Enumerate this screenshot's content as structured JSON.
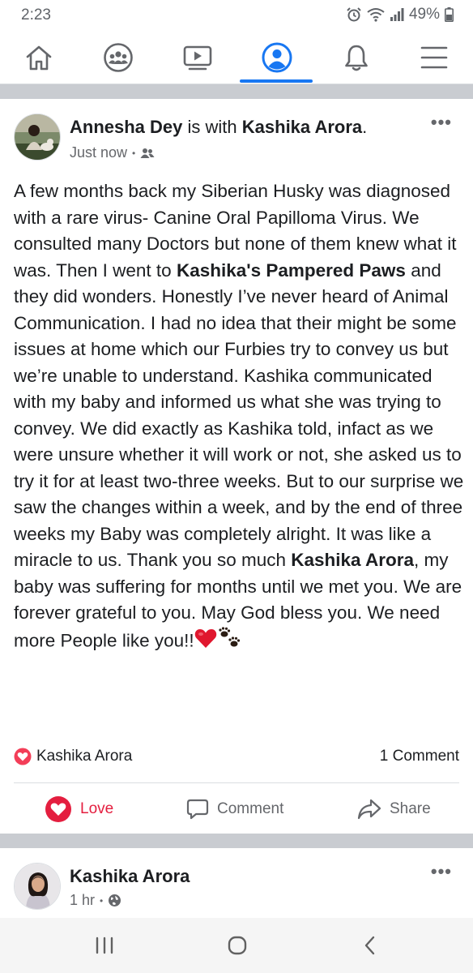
{
  "status": {
    "time": "2:23",
    "battery": "49%"
  },
  "nav": {
    "items": [
      {
        "name": "home-icon"
      },
      {
        "name": "groups-icon"
      },
      {
        "name": "watch-icon"
      },
      {
        "name": "profile-icon",
        "active": true
      },
      {
        "name": "notifications-icon"
      },
      {
        "name": "menu-icon"
      }
    ],
    "accent": "#1877f2"
  },
  "post": {
    "author": "Annesha Dey",
    "with_text": "is with",
    "tagged": "Kashika Arora",
    "period": ".",
    "time": "Just now",
    "separator": "•",
    "audience_icon": "friends-icon",
    "more": "•••",
    "body": {
      "p1": "A few months back my Siberian Husky was diagnosed with a rare virus- Canine Oral Papilloma Virus. We consulted many Doctors but none of them knew what it was. Then I went to ",
      "bold1": "Kashika's Pampered Paws",
      "p2": " and they did wonders. Honestly I’ve never heard of Animal Communication. I had no idea that their might be some issues at home which our Furbies try to convey us but we’re unable to understand. Kashika communicated with my baby and informed us what she was trying to convey. We did exactly as Kashika told, infact as we were unsure whether it will work or not, she asked us to try it for at least two-three weeks. But to our surprise we saw the changes within a week, and by the end of three weeks my Baby was completely alright. It was like a miracle to us. Thank you so much ",
      "bold2": "Kashika Arora",
      "p3": ", my baby was suffering for months until we met you. We are forever grateful to you. May God bless you. We need more People like you!!"
    },
    "reaction_user": "Kashika Arora",
    "comment_count": "1 Comment",
    "actions": {
      "love": "Love",
      "comment": "Comment",
      "share": "Share"
    },
    "love_color": "#e41e3f"
  },
  "post2": {
    "author": "Kashika Arora",
    "time": "1 hr",
    "separator": "•",
    "audience_icon": "globe-icon",
    "more": "•••"
  }
}
